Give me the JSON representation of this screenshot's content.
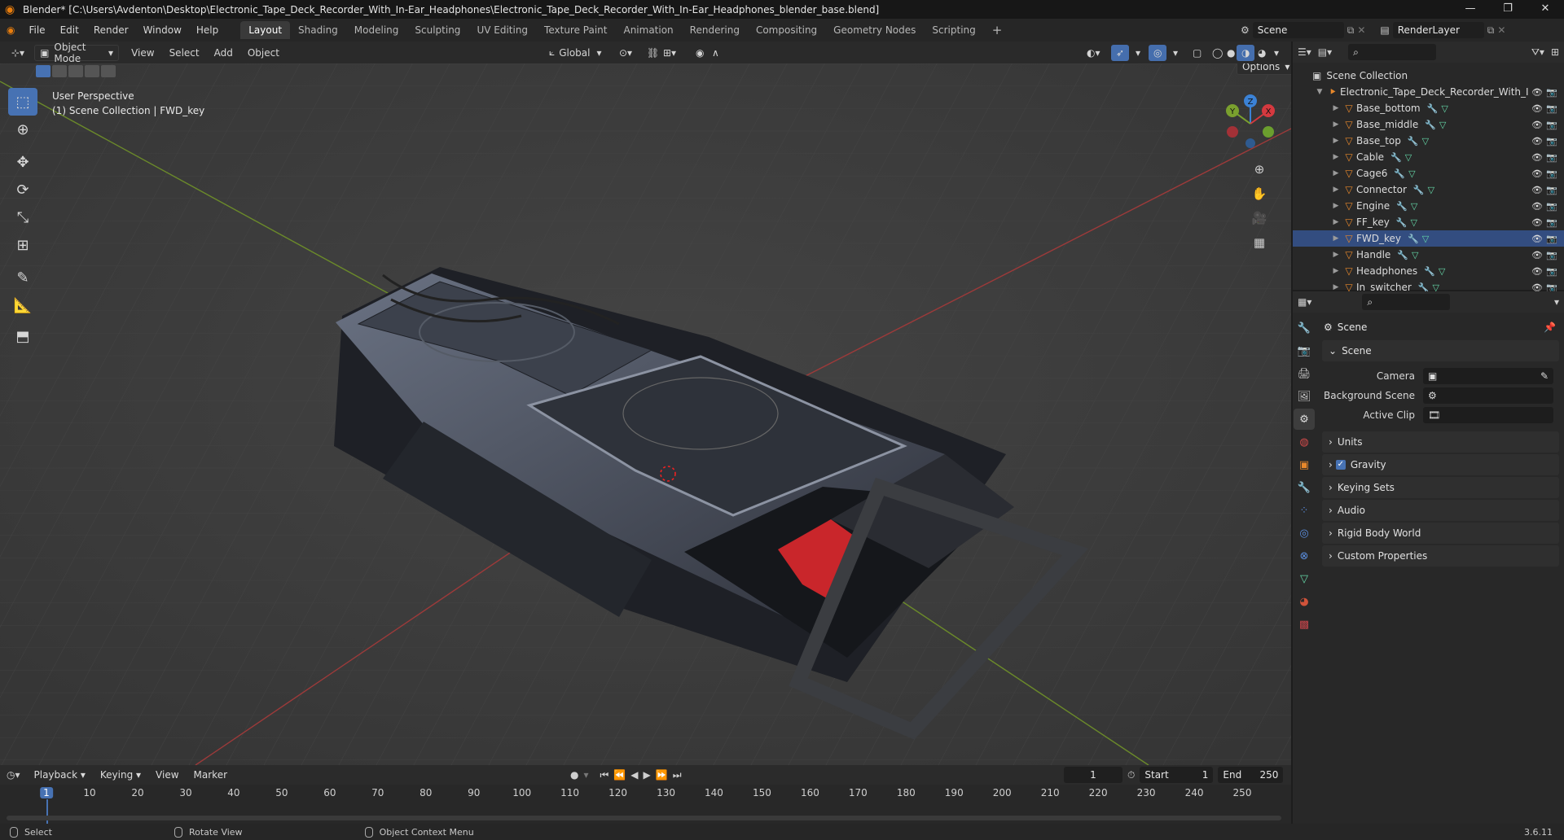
{
  "window": {
    "title": "Blender* [C:\\Users\\Avdenton\\Desktop\\Electronic_Tape_Deck_Recorder_With_In-Ear_Headphones\\Electronic_Tape_Deck_Recorder_With_In-Ear_Headphones_blender_base.blend]",
    "controls": [
      "—",
      "❐",
      "✕"
    ]
  },
  "menus": [
    "File",
    "Edit",
    "Render",
    "Window",
    "Help"
  ],
  "workspaces": [
    "Layout",
    "Shading",
    "Modeling",
    "Sculpting",
    "UV Editing",
    "Texture Paint",
    "Animation",
    "Rendering",
    "Compositing",
    "Geometry Nodes",
    "Scripting"
  ],
  "active_workspace": "Layout",
  "add_workspace": "+",
  "scene": {
    "label": "Scene",
    "layer": "RenderLayer"
  },
  "viewport": {
    "mode": "Object Mode",
    "menus": [
      "View",
      "Select",
      "Add",
      "Object"
    ],
    "orientation": "Global",
    "options": "Options",
    "overlay_line1": "User Perspective",
    "overlay_line2": "(1) Scene Collection | FWD_key",
    "gizmo": {
      "z": "Z",
      "y": "Y",
      "x": "X"
    }
  },
  "outliner": {
    "root": "Scene Collection",
    "collection": "Electronic_Tape_Deck_Recorder_With_I",
    "objects": [
      "Base_bottom",
      "Base_middle",
      "Base_top",
      "Cable",
      "Cage6",
      "Connector",
      "Engine",
      "FF_key",
      "FWD_key",
      "Handle",
      "Headphones",
      "In_switcher"
    ],
    "selected": "FWD_key"
  },
  "properties": {
    "context": "Scene",
    "panel_title": "Scene",
    "fields": [
      {
        "label": "Camera",
        "value": ""
      },
      {
        "label": "Background Scene",
        "value": ""
      },
      {
        "label": "Active Clip",
        "value": ""
      }
    ],
    "collapsed_panels": [
      "Units",
      "Gravity",
      "Keying Sets",
      "Audio",
      "Rigid Body World",
      "Custom Properties"
    ],
    "gravity_checked": true
  },
  "timeline": {
    "menus": [
      "Playback",
      "Keying",
      "View",
      "Marker"
    ],
    "current_frame": "1",
    "start_label": "Start",
    "start": "1",
    "end_label": "End",
    "end": "250",
    "ticks": [
      "1",
      "10",
      "20",
      "30",
      "40",
      "50",
      "60",
      "70",
      "80",
      "90",
      "100",
      "110",
      "120",
      "130",
      "140",
      "150",
      "160",
      "170",
      "180",
      "190",
      "200",
      "210",
      "220",
      "230",
      "240",
      "250"
    ]
  },
  "status": {
    "left": "Select",
    "middle": "Rotate View",
    "right": "Object Context Menu",
    "version": "3.6.11"
  }
}
